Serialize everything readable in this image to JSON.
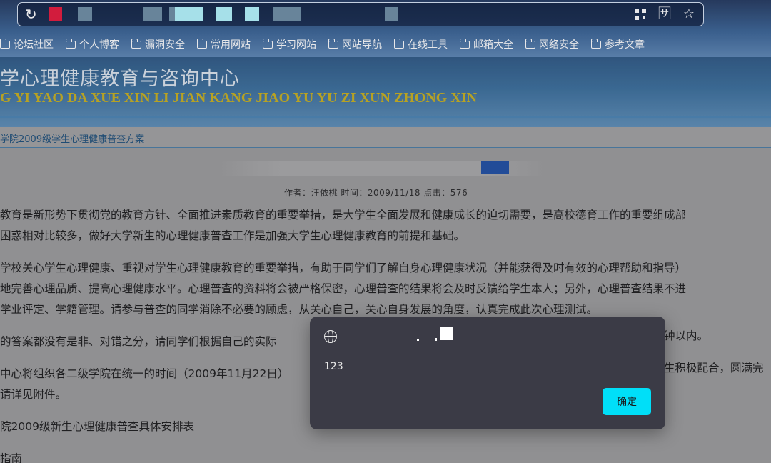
{
  "bookmarks": [
    "论坛社区",
    "个人博客",
    "漏洞安全",
    "常用网站",
    "学习网站",
    "网站导航",
    "在线工具",
    "邮箱大全",
    "网络安全",
    "参考文章"
  ],
  "site": {
    "title": "学心理健康教育与咨询中心",
    "pinyin": "G YI YAO DA XUE XIN LI JIAN KANG JIAO YU YU ZI XUN ZHONG XIN"
  },
  "breadcrumb": "学院2009级学生心理健康普查方案",
  "article": {
    "meta": "作者：汪依桃 时间：2009/11/18 点击：576",
    "paragraphs": [
      "教育是新形势下贯彻党的教育方针、全面推进素质教育的重要举措，是大学生全面发展和健康成长的迫切需要，是高校德育工作的重要组成部",
      "困惑相对比较多，做好大学新生的心理健康普查工作是加强大学生心理健康教育的前提和基础。",
      "",
      "学校关心学生心理健康、重视对学生心理健康教育的重要举措，有助于同学们了解自身心理健康状况（并能获得及时有效的心理帮助和指导）",
      "地完善心理品质、提高心理健康水平。心理普查的资料将会被严格保密，心理普查的结果将会及时反馈给学生本人；另外，心理普查结果不进",
      "学业评定、学籍管理。请参与普查的同学消除不必要的顾虑，从关心自己，关心自身发展的角度，认真完成此次心理测试。",
      "",
      "的答案都没有是非、对错之分，请同学们根据自己的实际",
      "",
      "中心将组织各二级学院在统一的时间（2009年11月22日）",
      "请详见附件。",
      "",
      "院2009级新生心理健康普查具体安排表",
      "",
      "指南"
    ],
    "right_fragments": [
      "钟以内。",
      "生积极配合，圆满完"
    ]
  },
  "dialog": {
    "message": "123",
    "ok_label": "确定"
  },
  "colors": {
    "ok_button": "#00dff8",
    "dialog_bg": "#3b3b46",
    "pinyin": "#c9b11e",
    "title_mark": "#1f4fa3"
  }
}
